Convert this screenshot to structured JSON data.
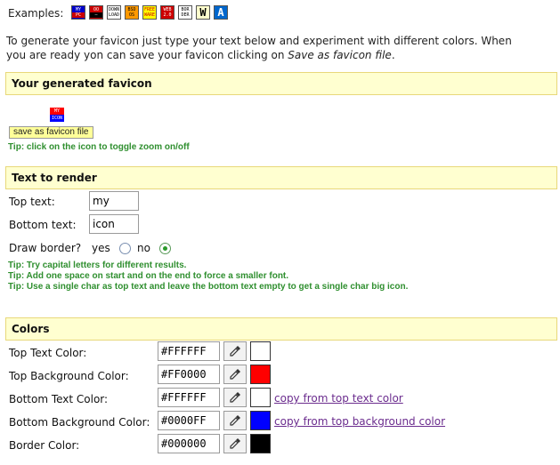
{
  "examples": {
    "label": "Examples:",
    "icons": [
      {
        "top": "MY",
        "bottom": "PC",
        "top_bg": "#0000cc",
        "bottom_bg": "#cc0000",
        "fg": "#ffffff"
      },
      {
        "top": "OO",
        "bottom": "—",
        "top_bg": "#cc0000",
        "bottom_bg": "#000000",
        "fg": "#ffffff"
      },
      {
        "top": "DOWN",
        "bottom": "LOAD",
        "top_bg": "#ffffff",
        "bottom_bg": "#ffffff",
        "fg": "#000000"
      },
      {
        "top": "BSD",
        "bottom": "OS",
        "top_bg": "#ff9900",
        "bottom_bg": "#ff9900",
        "fg": "#000000"
      },
      {
        "top": "FREE",
        "bottom": "WARE",
        "top_bg": "#ffff00",
        "bottom_bg": "#ffff00",
        "fg": "#cc0000"
      },
      {
        "top": "WEB",
        "bottom": "2.0",
        "top_bg": "#cc0000",
        "bottom_bg": "#cc0000",
        "fg": "#ffffff"
      },
      {
        "top": "BOR",
        "bottom": "DER",
        "top_bg": "#ffffff",
        "bottom_bg": "#ffffff",
        "fg": "#000000"
      },
      {
        "top": "W",
        "bottom": "",
        "top_bg": "#ffffcc",
        "bottom_bg": "#ffffcc",
        "fg": "#000000"
      },
      {
        "top": "A",
        "bottom": "",
        "top_bg": "#0066cc",
        "bottom_bg": "#0066cc",
        "fg": "#ffffff"
      }
    ]
  },
  "intro": {
    "line1": "To generate your favicon just type your text below and experiment with different colors. When",
    "line2_prefix": "you are ready yon can save your favicon clicking on ",
    "line2_em": "Save as favicon file",
    "line2_suffix": "."
  },
  "generated": {
    "header": "Your generated favicon",
    "favicon_top": "MY",
    "favicon_bottom": "ICON",
    "save_button": "save as favicon file",
    "tip": "Tip: click on the icon to toggle zoom on/off"
  },
  "text_section": {
    "header": "Text to render",
    "top_label": "Top text:",
    "top_value": "my",
    "bottom_label": "Bottom text:",
    "bottom_value": "icon",
    "border_label": "Draw border?",
    "yes_label": "yes",
    "no_label": "no",
    "border_selected": "no",
    "tips": [
      "Tip: Try capital letters for different results.",
      "Tip: Add one space on start and on the end to force a smaller font.",
      "Tip: Use a single char as top text and leave the bottom text empty to get a single char big icon."
    ]
  },
  "colors": {
    "header": "Colors",
    "rows": [
      {
        "label": "Top Text Color:",
        "value": "#FFFFFF",
        "swatch": "#FFFFFF",
        "link": ""
      },
      {
        "label": "Top Background Color:",
        "value": "#FF0000",
        "swatch": "#FF0000",
        "link": ""
      },
      {
        "label": "Bottom Text Color:",
        "value": "#FFFFFF",
        "swatch": "#FFFFFF",
        "link": "copy from top text color"
      },
      {
        "label": "Bottom Background Color:",
        "value": "#0000FF",
        "swatch": "#0000FF",
        "link": "copy from top background color"
      },
      {
        "label": "Border Color:",
        "value": "#000000",
        "swatch": "#000000",
        "link": ""
      }
    ]
  }
}
